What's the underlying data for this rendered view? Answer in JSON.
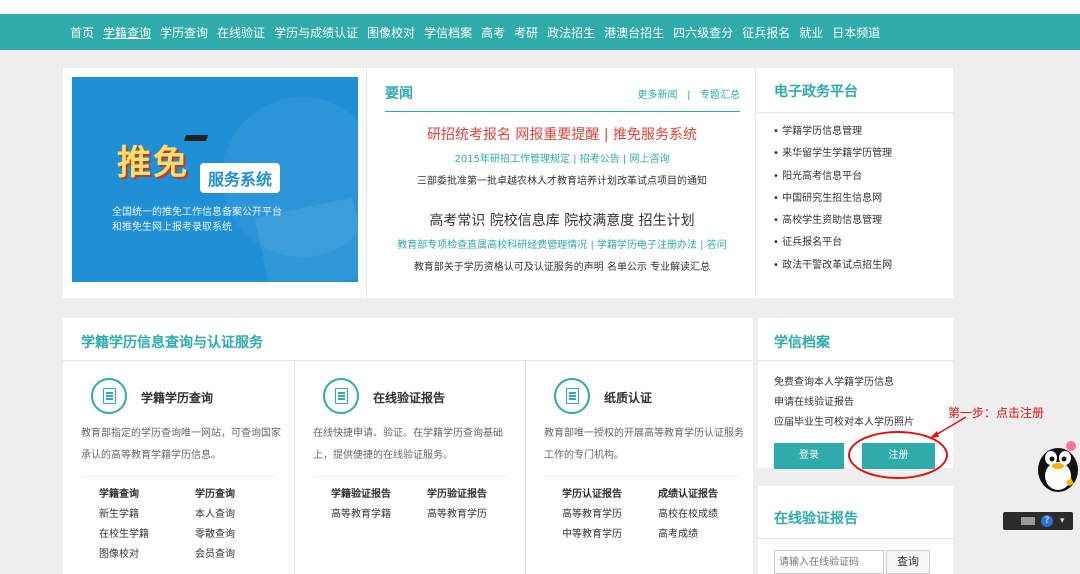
{
  "nav": [
    "首页",
    "学籍查询",
    "学历查询",
    "在线验证",
    "学历与成绩认证",
    "图像校对",
    "学信档案",
    "高考",
    "考研",
    "政法招生",
    "港澳台招生",
    "四六级查分",
    "征兵报名",
    "就业",
    "日本频道"
  ],
  "banner": {
    "title_big": "推免",
    "title_box": "服务系统",
    "caption_1": "全国统一的推免工作信息备案公开平台",
    "caption_2": "和推免生网上报考录取系统"
  },
  "news": {
    "heading": "要闻",
    "more": "更多新闻",
    "sep": "|",
    "topics": "专题汇总",
    "line1": "研招统考报名  网报重要提醒 | 推免服务系统",
    "line2": "2015年研招工作管理规定 | 招考公告 | 网上咨询",
    "line3": "三部委批准第一批卓越农林人才教育培养计划改革试点项目的通知",
    "line4": "高考常识 院校信息库 院校满意度 招生计划",
    "line5": "教育部专项检查直属高校科研经费管理情况 | 学籍学历电子注册办法 | 答问",
    "line6": "教育部关于学历资格认可及认证服务的声明 名单公示 专业解读汇总"
  },
  "gov": {
    "heading": "电子政务平台",
    "items": [
      "学籍学历信息管理",
      "来华留学生学籍学历管理",
      "阳光高考信息平台",
      "中国研究生招生信息网",
      "高校学生资助信息管理",
      "征兵报名平台",
      "政法干警改革试点招生网"
    ]
  },
  "services": {
    "heading": "学籍学历信息查询与认证服务",
    "cols": [
      {
        "title": "学籍学历查询",
        "desc": "教育部指定的学历查询唯一网站，可查询国家承认的高等教育学籍学历信息。",
        "links": [
          "学籍查询",
          "学历查询",
          "新生学籍",
          "本人查询",
          "在校生学籍",
          "零散查询",
          "图像校对",
          "会员查询"
        ]
      },
      {
        "title": "在线验证报告",
        "desc": "在线快捷申请、验证。在学籍学历查询基础上，提供便捷的在线验证服务。",
        "links": [
          "学籍验证报告",
          "学历验证报告",
          "高等教育学籍",
          "高等教育学历"
        ]
      },
      {
        "title": "纸质认证",
        "desc": "教育部唯一授权的开展高等教育学历认证服务工作的专门机构。",
        "links": [
          "学历认证报告",
          "成绩认证报告",
          "高等教育学历",
          "高校在校成绩",
          "中等教育学历",
          "高考成绩"
        ]
      }
    ]
  },
  "xuexin": {
    "heading": "学信档案",
    "items": [
      "免费查询本人学籍学历信息",
      "申请在线验证报告",
      "应届毕业生可校对本人学历照片"
    ],
    "login": "登录",
    "register": "注册"
  },
  "annotation": {
    "step": "第一步：点击注册"
  },
  "verify": {
    "heading": "在线验证报告",
    "placeholder": "请输入在线验证码",
    "query": "查询"
  },
  "qq_toolbar": {
    "help": "?"
  },
  "colors": {
    "accent": "#2eabaa",
    "highlight": "#e0443a",
    "annotation": "#e0120f"
  }
}
